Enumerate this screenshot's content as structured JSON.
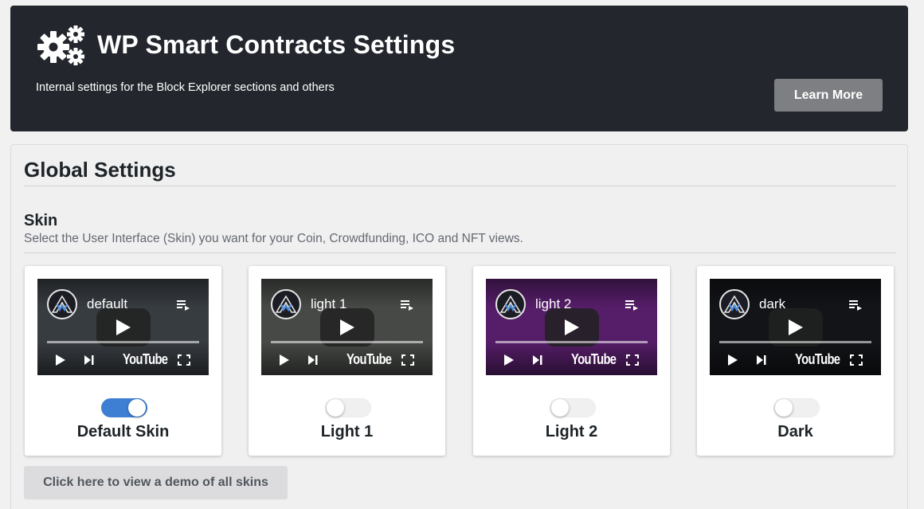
{
  "header": {
    "title": "WP Smart Contracts Settings",
    "subtitle": "Internal settings for the Block Explorer sections and others",
    "learn_more_label": "Learn More",
    "icon": "gears-icon"
  },
  "global": {
    "title": "Global Settings",
    "skin": {
      "heading": "Skin",
      "description": "Select the User Interface (Skin) you want for your Coin, Crowdfunding, ICO and NFT views.",
      "options": [
        {
          "label": "Default Skin",
          "video_title": "default",
          "selected": true,
          "youtube_text": "YouTube",
          "thumb_color": "#3a3f44"
        },
        {
          "label": "Light 1",
          "video_title": "light 1",
          "selected": false,
          "youtube_text": "YouTube",
          "thumb_color": "#4a4d4a"
        },
        {
          "label": "Light 2",
          "video_title": "light 2",
          "selected": false,
          "youtube_text": "YouTube",
          "thumb_color": "#5a1f6e"
        },
        {
          "label": "Dark",
          "video_title": "dark",
          "selected": false,
          "youtube_text": "YouTube",
          "thumb_color": "#141519"
        }
      ]
    },
    "demo_button_label": "Click here to view a demo of all skins"
  },
  "colors": {
    "header_bg": "#23272d",
    "accent": "#3e7fd3",
    "learn_more_bg": "#7d7f82"
  }
}
